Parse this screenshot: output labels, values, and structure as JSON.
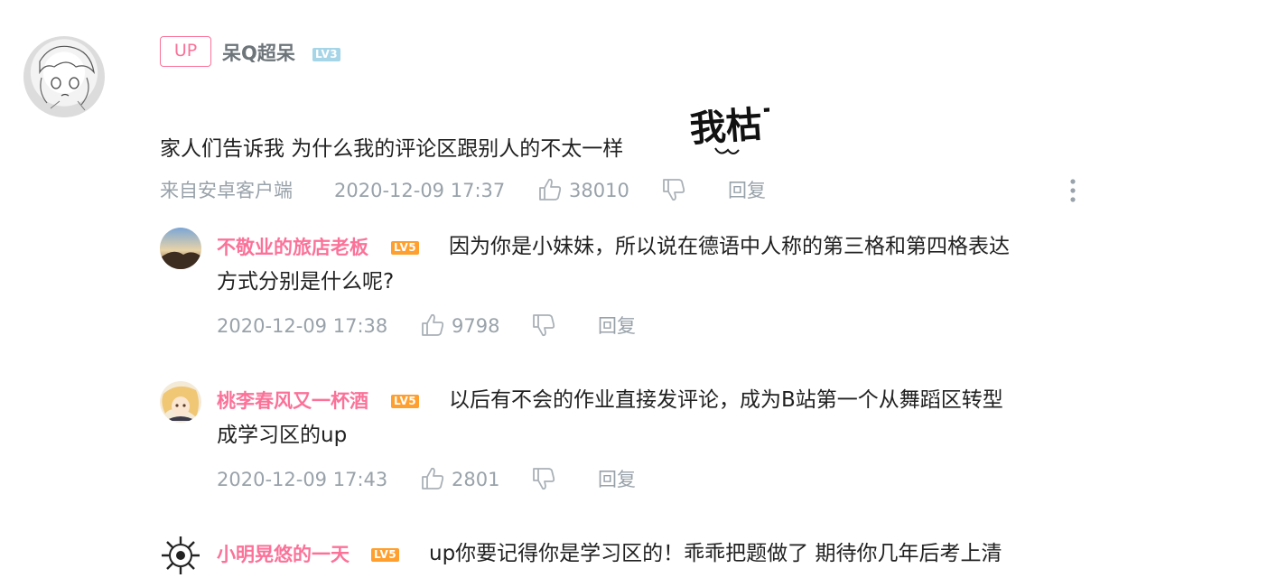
{
  "comment": {
    "up_badge": "UP",
    "username": "呆Q超呆",
    "level": "LV3",
    "text": "家人们告诉我 为什么我的评论区跟别人的不太一样",
    "sticker": "我枯了",
    "source": "来自安卓客户端",
    "timestamp": "2020-12-09 17:37",
    "likes": "38010",
    "reply_label": "回复"
  },
  "replies": [
    {
      "username": "不敬业的旅店老板",
      "level": "LV5",
      "text_line1": "因为你是小妹妹，所以说在德语中人称的第三格和第四格表达",
      "text_line2": "方式分别是什么呢?",
      "timestamp": "2020-12-09 17:38",
      "likes": "9798",
      "reply_label": "回复"
    },
    {
      "username": "桃李春风又一杯酒",
      "level": "LV5",
      "text_line1": "以后有不会的作业直接发评论，成为B站第一个从舞蹈区转型",
      "text_line2": "成学习区的up",
      "timestamp": "2020-12-09 17:43",
      "likes": "2801",
      "reply_label": "回复"
    },
    {
      "username": "小明晃悠的一天",
      "level": "LV5",
      "text_line1": "up你要记得你是学习区的！乖乖把题做了 期待你几年后考上清"
    }
  ],
  "icons": {
    "like": "thumbs-up-icon",
    "dislike": "thumbs-down-icon",
    "more": "more-vertical-icon"
  },
  "colors": {
    "accent_pink": "#fb7299",
    "meta_gray": "#99a2aa",
    "level3": "#a6d5e8",
    "level5": "#ff9f2e"
  }
}
